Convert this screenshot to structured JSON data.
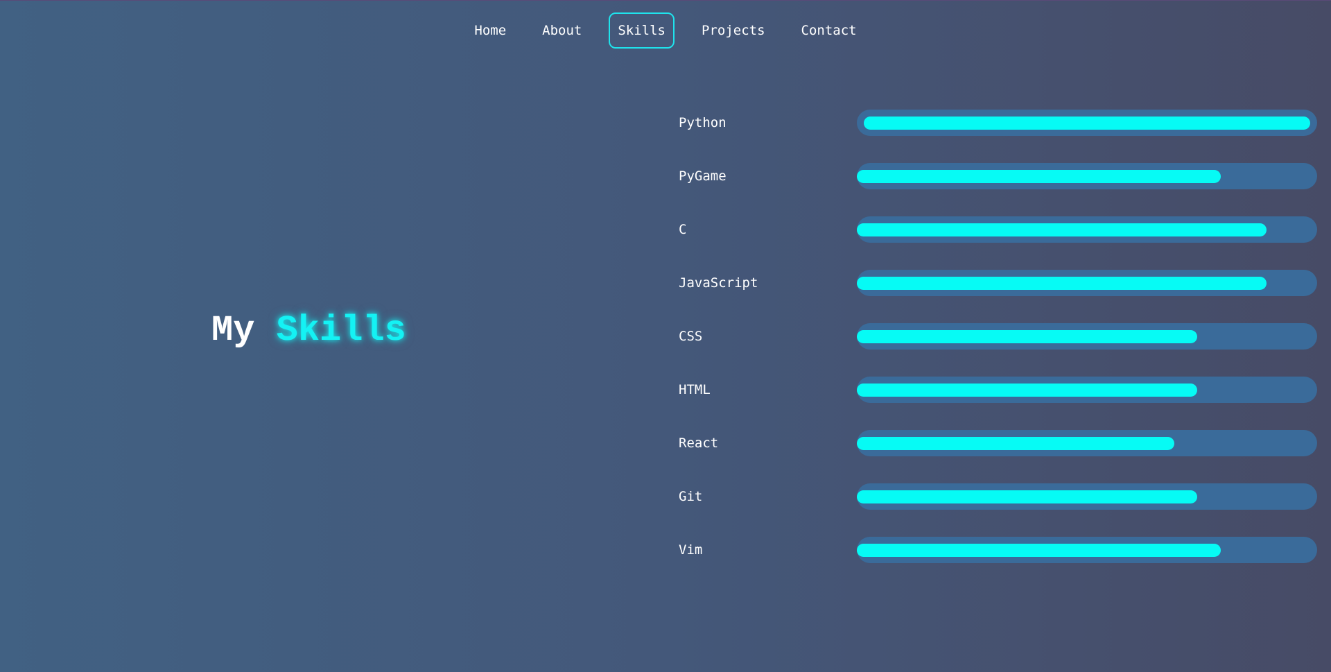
{
  "nav": {
    "items": [
      "Home",
      "About",
      "Skills",
      "Projects",
      "Contact"
    ],
    "active": "Skills"
  },
  "heading": {
    "word1": "My",
    "word2": "Skills"
  },
  "skills": [
    {
      "name": "Python",
      "level": 1.0
    },
    {
      "name": "PyGame",
      "level": 0.79
    },
    {
      "name": "C",
      "level": 0.89
    },
    {
      "name": "JavaScript",
      "level": 0.89
    },
    {
      "name": "CSS",
      "level": 0.74
    },
    {
      "name": "HTML",
      "level": 0.74
    },
    {
      "name": "React",
      "level": 0.69
    },
    {
      "name": "Git",
      "level": 0.74
    },
    {
      "name": "Vim",
      "level": 0.79
    }
  ],
  "colors": {
    "accent": "#06fbf5",
    "track": "#3a6b9a",
    "text": "#ffffff"
  }
}
